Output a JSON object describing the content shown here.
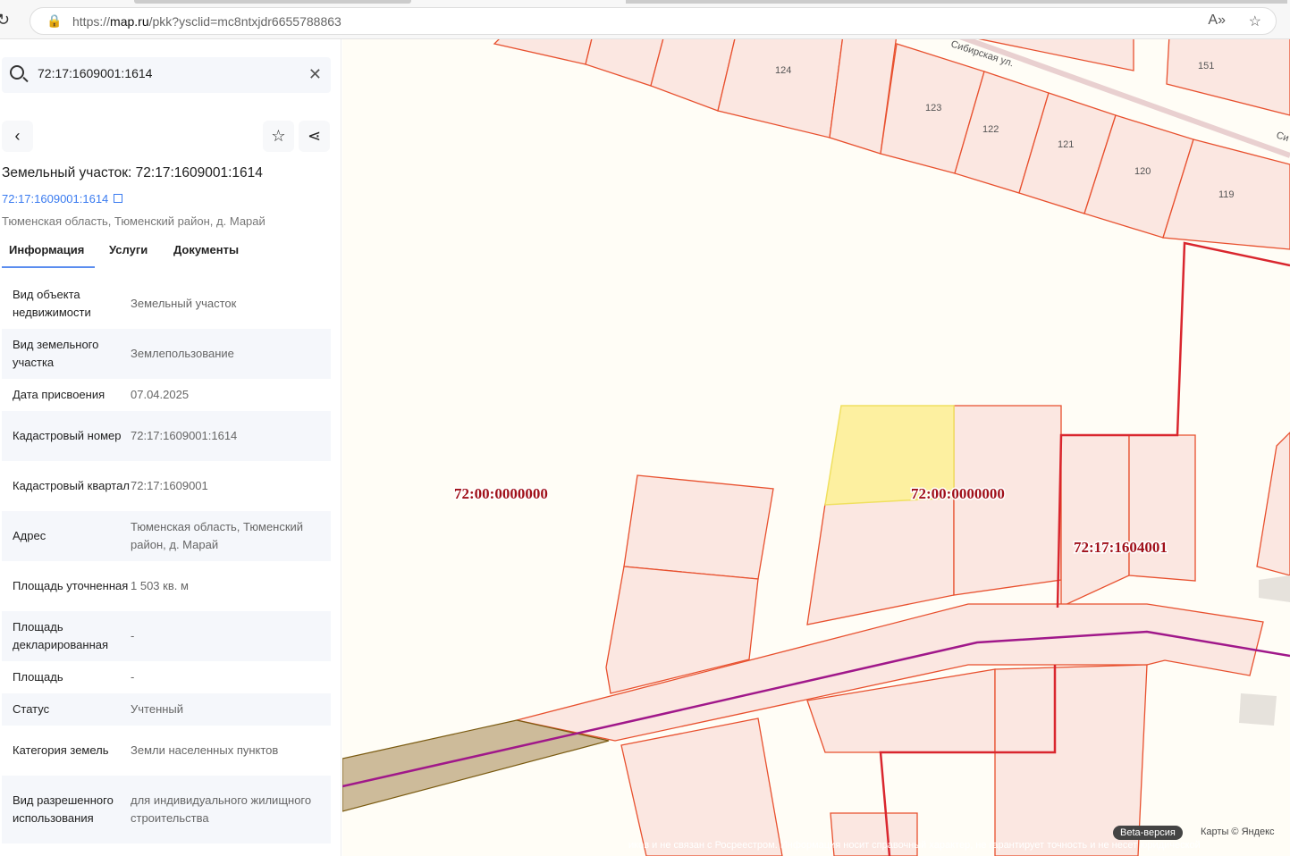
{
  "browser": {
    "url_prefix": "https://",
    "url_domain": "map.ru",
    "url_path": "/pkk?ysclid=mc8ntxjdr6655788863"
  },
  "search": {
    "value": "72:17:1609001:1614"
  },
  "object": {
    "title": "Земельный участок: 72:17:1609001:1614",
    "cad_link": "72:17:1609001:1614",
    "address": "Тюменская область, Тюменский район, д. Марай"
  },
  "tabs": [
    {
      "label": "Информация"
    },
    {
      "label": "Услуги"
    },
    {
      "label": "Документы"
    }
  ],
  "info": [
    {
      "key": "Вид объекта недвижимости",
      "value": "Земельный участок"
    },
    {
      "key": "Вид земельного участка",
      "value": "Землепользование"
    },
    {
      "key": "Дата присвоения",
      "value": "07.04.2025"
    },
    {
      "key": "Кадастровый номер",
      "value": "72:17:1609001:1614"
    },
    {
      "key": "Кадастровый квартал",
      "value": "72:17:1609001"
    },
    {
      "key": "Адрес",
      "value": "Тюменская область, Тюменский район, д. Марай"
    },
    {
      "key": "Площадь уточненная",
      "value": "1 503 кв. м"
    },
    {
      "key": "Площадь декларированная",
      "value": "-"
    },
    {
      "key": "Площадь",
      "value": "-"
    },
    {
      "key": "Статус",
      "value": "Учтенный"
    },
    {
      "key": "Категория земель",
      "value": "Земли населенных пунктов"
    },
    {
      "key": "Вид разрешенного использования",
      "value": "для индивидуального жилищного строительства"
    }
  ],
  "map": {
    "quarter_labels": [
      "72:00:0000000",
      "72:00:0000000",
      "72:17:1604001"
    ],
    "parcel_numbers": [
      "124",
      "123",
      "122",
      "121",
      "120",
      "119",
      "151"
    ],
    "street": "Сибирская ул.",
    "street_cut": "Си",
    "beta": "Beta-версия",
    "copyright": "Карты © Яндекс",
    "disclaimer": "иков и не связан с Росреестром. Информация носит справочный характер, не гарантирует точность и не несет юридической",
    "colors": {
      "parcel_fill": "#fbe7e1",
      "parcel_stroke": "#e8502e",
      "quarter_stroke": "#d9262e",
      "selected": "#fdf0a0",
      "road": "#a0188a",
      "zone": "#cdbb9a"
    }
  }
}
